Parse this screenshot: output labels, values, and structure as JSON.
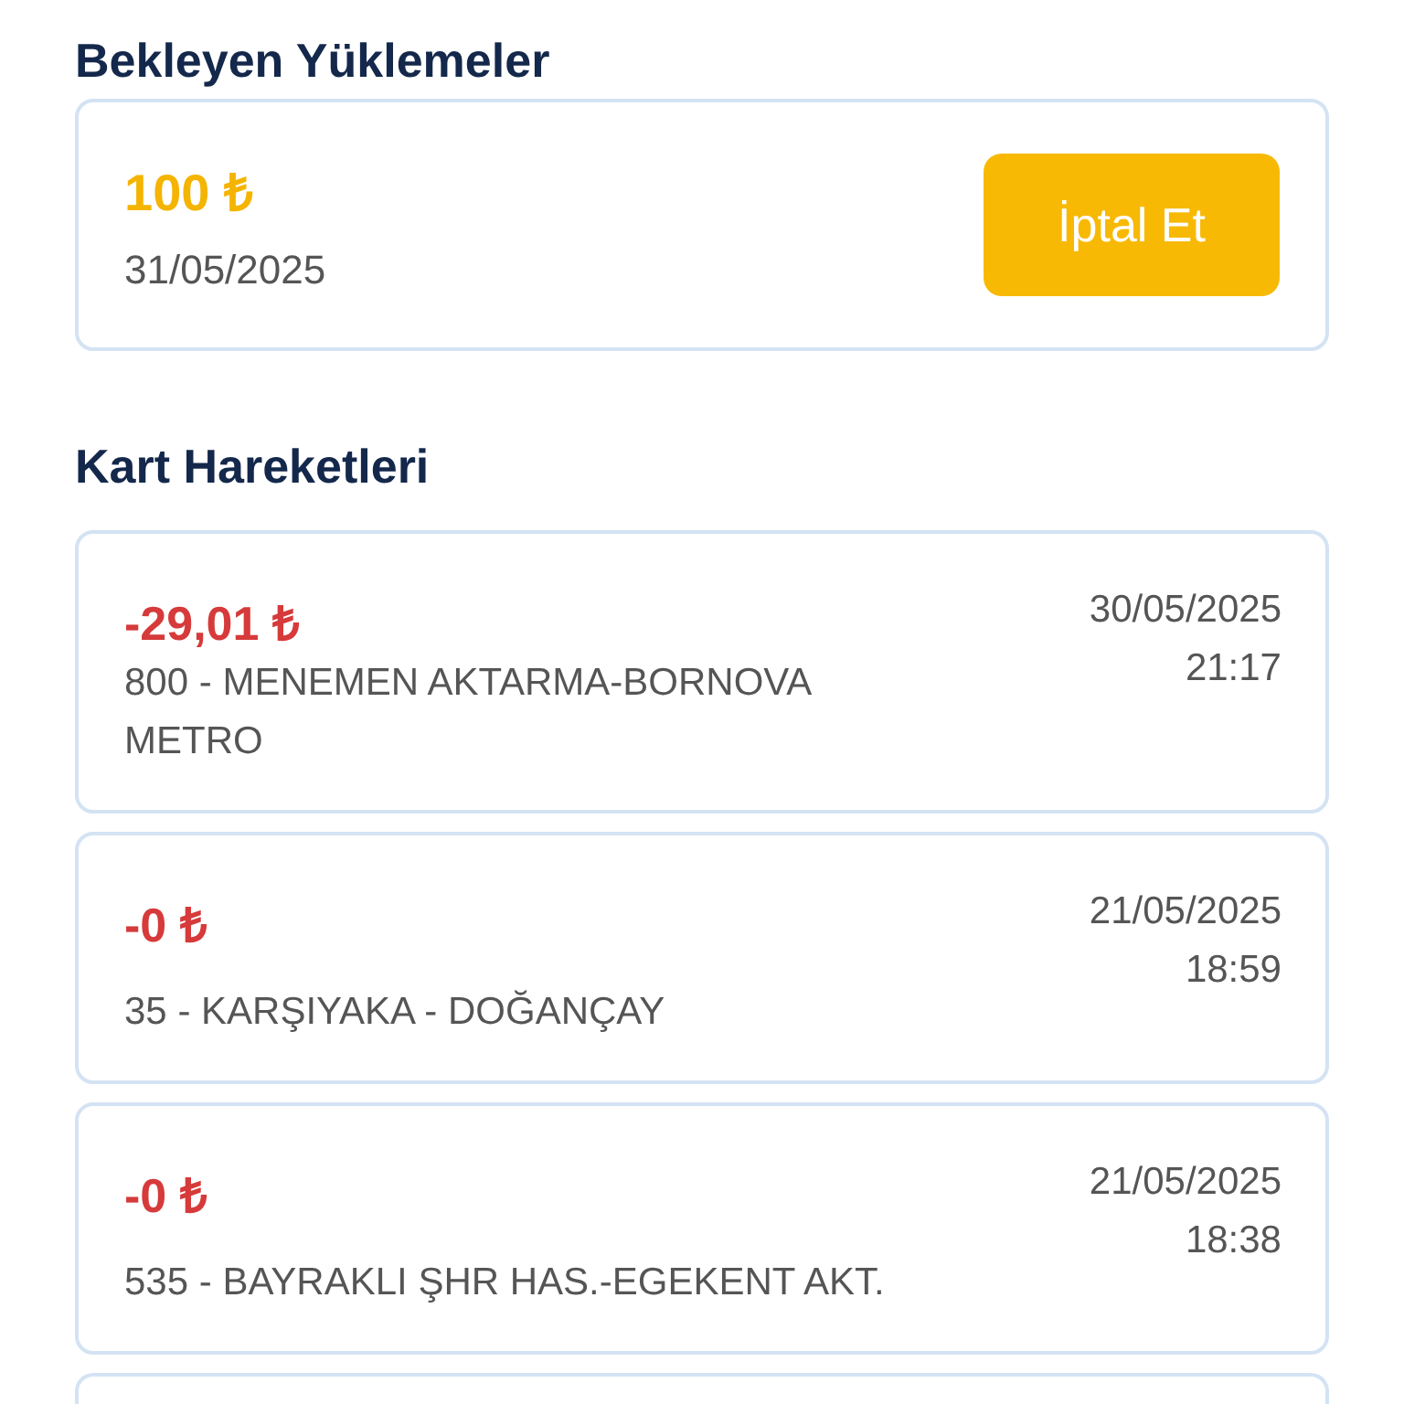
{
  "pending": {
    "title": "Bekleyen Yüklemeler",
    "items": [
      {
        "amount": "100 ₺",
        "date": "31/05/2025",
        "button": "İptal Et"
      }
    ]
  },
  "movements": {
    "title": "Kart Hareketleri",
    "items": [
      {
        "amount": "-29,01 ₺",
        "route": "800 - MENEMEN AKTARMA-BORNOVA METRO",
        "date": "30/05/2025",
        "time": "21:17"
      },
      {
        "amount": "-0 ₺",
        "route": "35 - KARŞIYAKA - DOĞANÇAY",
        "date": "21/05/2025",
        "time": "18:59"
      },
      {
        "amount": "-0 ₺",
        "route": "535 - BAYRAKLI ŞHR HAS.-EGEKENT AKT.",
        "date": "21/05/2025",
        "time": "18:38"
      }
    ]
  }
}
